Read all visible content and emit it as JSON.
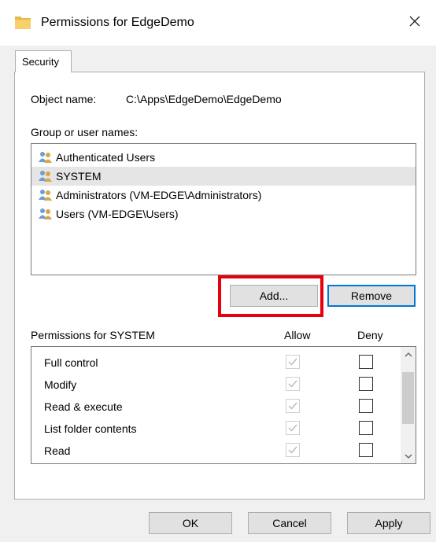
{
  "window": {
    "title": "Permissions for EdgeDemo"
  },
  "tabs": [
    {
      "label": "Security"
    }
  ],
  "object": {
    "label": "Object name:",
    "value": "C:\\Apps\\EdgeDemo\\EdgeDemo"
  },
  "groups": {
    "label": "Group or user names:",
    "items": [
      {
        "label": "Authenticated Users"
      },
      {
        "label": "SYSTEM"
      },
      {
        "label": "Administrators (VM-EDGE\\Administrators)"
      },
      {
        "label": "Users (VM-EDGE\\Users)"
      }
    ],
    "selected_index": 1
  },
  "buttons": {
    "add": "Add...",
    "remove": "Remove",
    "ok": "OK",
    "cancel": "Cancel",
    "apply": "Apply"
  },
  "permissions": {
    "title": "Permissions for SYSTEM",
    "allow_header": "Allow",
    "deny_header": "Deny",
    "rows": [
      {
        "name": "Full control",
        "allow": true,
        "deny": false
      },
      {
        "name": "Modify",
        "allow": true,
        "deny": false
      },
      {
        "name": "Read & execute",
        "allow": true,
        "deny": false
      },
      {
        "name": "List folder contents",
        "allow": true,
        "deny": false
      },
      {
        "name": "Read",
        "allow": true,
        "deny": false
      }
    ]
  },
  "colors": {
    "highlight": "#e8000f",
    "focus": "#0078d7",
    "selection": "#e5e5e5"
  },
  "icons": {
    "title": "folder-icon",
    "close": "close-icon",
    "user": "users-icon"
  }
}
